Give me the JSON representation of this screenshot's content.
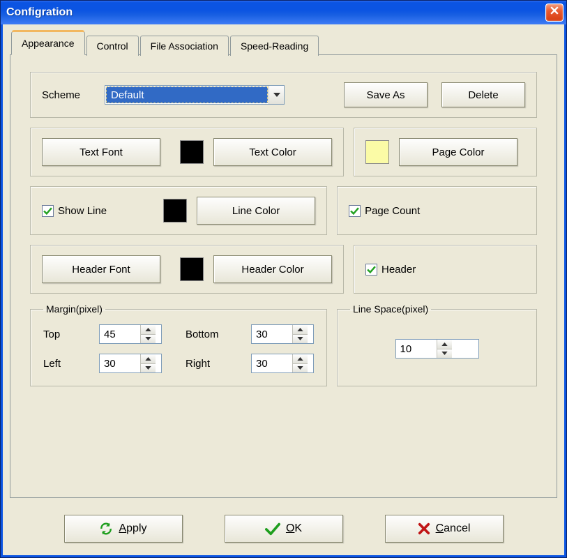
{
  "window": {
    "title": "Configration"
  },
  "tabs": {
    "appearance": "Appearance",
    "control": "Control",
    "file_assoc": "File Association",
    "speed": "Speed-Reading"
  },
  "scheme": {
    "label": "Scheme",
    "value": "Default",
    "save_as": "Save As",
    "delete": "Delete"
  },
  "text_section": {
    "text_font_btn": "Text Font",
    "text_color_btn": "Text Color",
    "page_color_btn": "Page Color",
    "text_color": "#000000",
    "page_color": "#fbfba6"
  },
  "line_section": {
    "show_line_label": "Show Line",
    "show_line_checked": true,
    "line_color_btn": "Line Color",
    "line_color": "#000000",
    "page_count_label": "Page Count",
    "page_count_checked": true
  },
  "header_section": {
    "header_font_btn": "Header Font",
    "header_color_btn": "Header Color",
    "header_color": "#000000",
    "header_label": "Header",
    "header_checked": true
  },
  "margin": {
    "legend": "Margin(pixel)",
    "top_label": "Top",
    "top": "45",
    "bottom_label": "Bottom",
    "bottom": "30",
    "left_label": "Left",
    "left": "30",
    "right_label": "Right",
    "right": "30"
  },
  "linespace": {
    "legend": "Line Space(pixel)",
    "value": "10"
  },
  "buttons": {
    "apply_prefix": "A",
    "apply_rest": "pply",
    "ok_prefix": "O",
    "ok_rest": "K",
    "cancel_prefix": "C",
    "cancel_rest": "ancel"
  }
}
